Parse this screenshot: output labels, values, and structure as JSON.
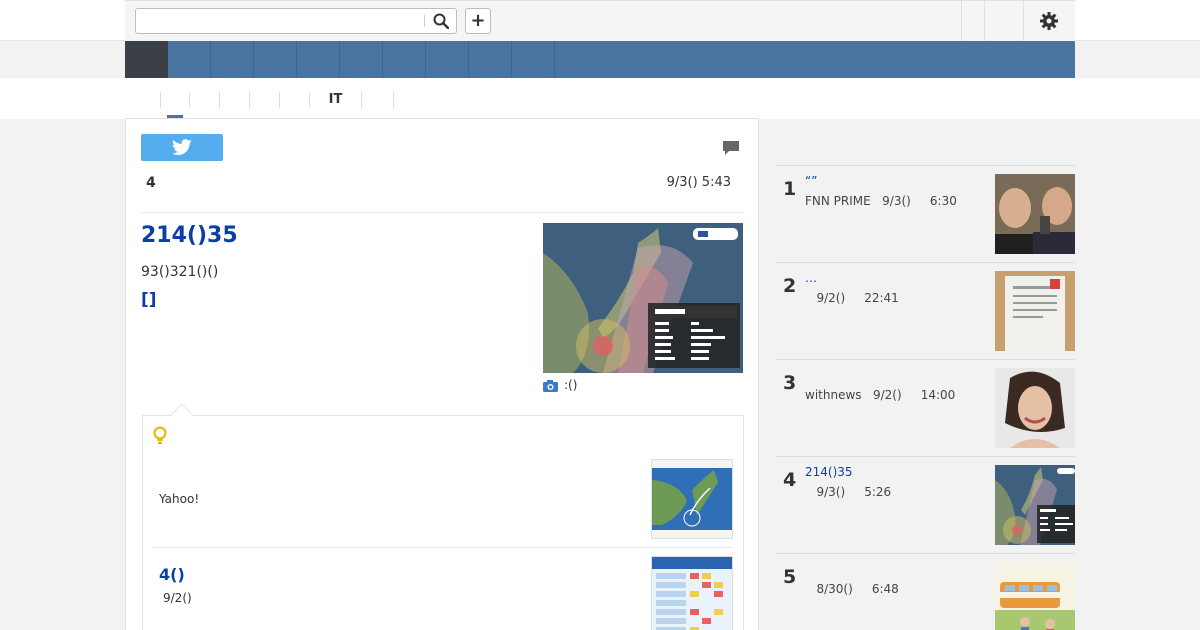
{
  "search": {
    "placeholder": "",
    "value": ""
  },
  "toolbar": {
    "add_label": "+"
  },
  "nav": {
    "items": [
      "",
      "",
      "",
      "",
      "",
      "",
      "",
      "",
      "",
      ""
    ]
  },
  "subtabs": [
    "",
    "",
    "",
    "",
    "",
    "IT",
    "",
    ""
  ],
  "article": {
    "comment_count": "4",
    "date": "9/3() 5:43",
    "title": "214()35",
    "body": "93()321()()",
    "link": "[]",
    "photo_caption": ":()"
  },
  "related": {
    "item1_text": "Yahoo!",
    "item2_title": "4()",
    "item2_date": "9/2()"
  },
  "ranking": [
    {
      "rank": "1",
      "title": "“”",
      "meta": "FNN PRIME   9/3()     6:30"
    },
    {
      "rank": "2",
      "title": "…",
      "meta": "   9/2()     22:41"
    },
    {
      "rank": "3",
      "title": "",
      "meta": "withnews   9/2()     14:00"
    },
    {
      "rank": "4",
      "title": "214()35",
      "meta": "   9/3()     5:26"
    },
    {
      "rank": "5",
      "title": "",
      "meta": "   8/30()     6:48"
    }
  ],
  "icons": {
    "search": "search-icon",
    "gear": "gear-icon",
    "twitter": "twitter-icon",
    "comment": "comment-icon",
    "camera": "camera-icon",
    "bulb": "lightbulb-icon"
  },
  "colors": {
    "nav": "#4a74a0",
    "nav_active": "#3a3f48",
    "link": "#0b3fa8",
    "twitter": "#55acee"
  }
}
